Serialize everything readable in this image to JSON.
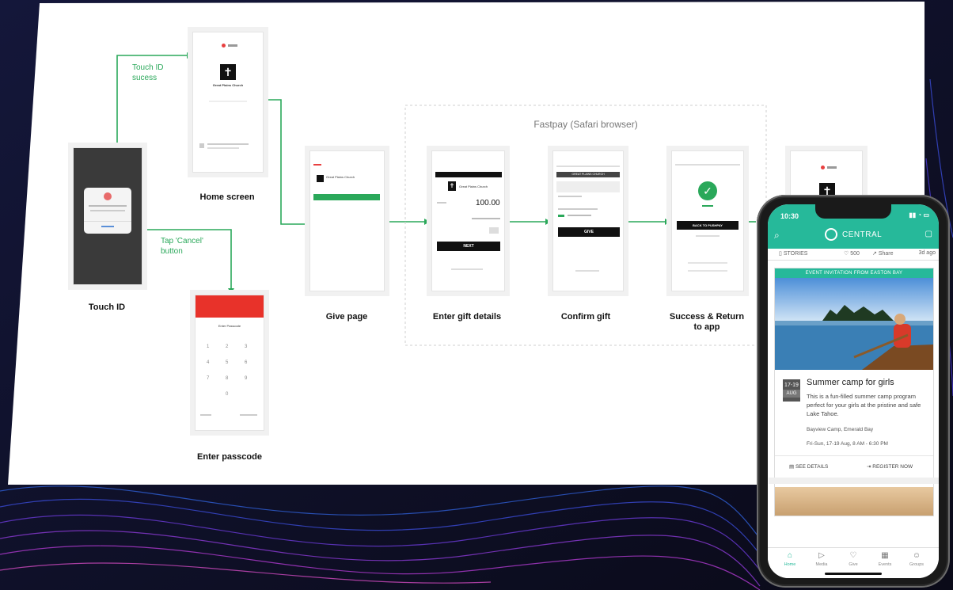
{
  "nodes": {
    "touch_id": "Touch ID",
    "home_screen": "Home screen",
    "enter_passcode": "Enter passcode",
    "give_page": "Give page",
    "enter_gift_details": "Enter gift details",
    "confirm_gift": "Confirm gift",
    "success_return": "Success & Return\nto app"
  },
  "edges": {
    "touch_success": "Touch ID\nsucess",
    "tap_cancel": "Tap 'Cancel'\nbutton"
  },
  "group": {
    "fastpay": "Fastpay (Safari browser)"
  },
  "mockups": {
    "church_name": "Great Plains Church",
    "amount": "100.00",
    "next_button": "NEXT",
    "give_button": "GIVE",
    "back_button": "BACK TO PUSHPAY",
    "confirm_header": "GREAT PLAINS CHURCH",
    "passcode_title": "Enter Passcode",
    "keypad": [
      "1",
      "2",
      "3",
      "4",
      "5",
      "6",
      "7",
      "8",
      "9",
      "0"
    ]
  },
  "phone": {
    "time": "10:30",
    "app_title": "CENTRAL",
    "toolbar": {
      "stories": "STORIES",
      "likes": "500",
      "share": "Share",
      "age": "3d ago"
    },
    "banner": "EVENT INVITATION FROM EASTON BAY",
    "date_day": "17-19",
    "date_month": "AUG",
    "event_title": "Summer camp for girls",
    "event_desc": "This is a fun-filled summer camp program perfect for your girls at the pristine and safe Lake Tahoe.",
    "event_location": "Bayview Camp, Emerald Bay",
    "event_time": "Fri-Sun, 17-19 Aug, 8 AM - 6:30 PM",
    "see_details": "SEE DETAILS",
    "register_now": "REGISTER NOW",
    "tabs": [
      {
        "label": "Home",
        "icon": "home-icon"
      },
      {
        "label": "Media",
        "icon": "play-icon"
      },
      {
        "label": "Give",
        "icon": "heart-icon"
      },
      {
        "label": "Events",
        "icon": "calendar-icon"
      },
      {
        "label": "Groups",
        "icon": "people-icon"
      }
    ],
    "accent": "#26b99a"
  },
  "colors": {
    "flow_green": "#2aa85a",
    "board": "#ffffff"
  }
}
